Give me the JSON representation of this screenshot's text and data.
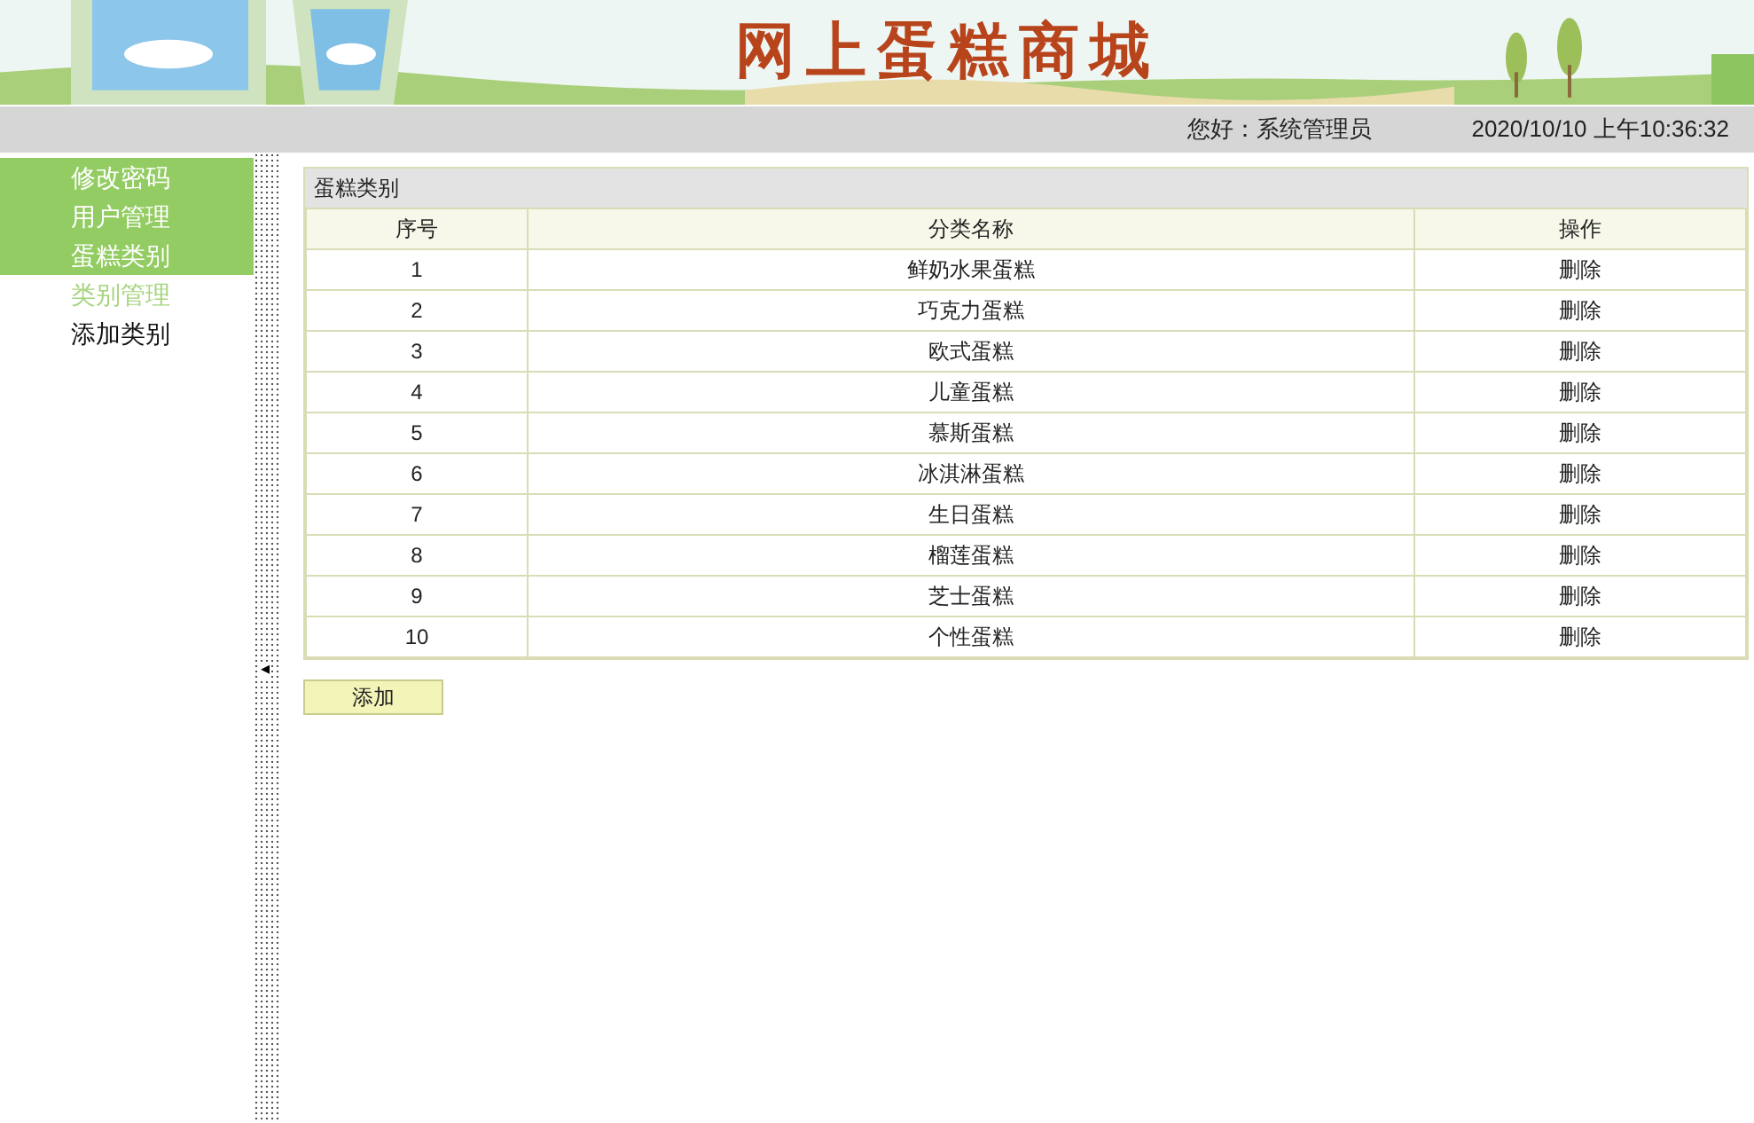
{
  "header": {
    "title": "网上蛋糕商城",
    "greeting": "您好：系统管理员",
    "datetime": "2020/10/10 上午10:36:32"
  },
  "sidebar": {
    "items": [
      {
        "kind": "group",
        "label": "修改密码",
        "selected": false
      },
      {
        "kind": "group",
        "label": "用户管理",
        "selected": false
      },
      {
        "kind": "group",
        "label": "蛋糕类别",
        "selected": false
      },
      {
        "kind": "item",
        "label": "类别管理",
        "selected": true
      },
      {
        "kind": "item",
        "label": "添加类别",
        "selected": false
      }
    ]
  },
  "splitter": {
    "arrow": "◂"
  },
  "table": {
    "title": "蛋糕类别",
    "columns": [
      "序号",
      "分类名称",
      "操作"
    ],
    "rows": [
      {
        "no": "1",
        "name": "鲜奶水果蛋糕",
        "action": "删除"
      },
      {
        "no": "2",
        "name": "巧克力蛋糕",
        "action": "删除"
      },
      {
        "no": "3",
        "name": "欧式蛋糕",
        "action": "删除"
      },
      {
        "no": "4",
        "name": "儿童蛋糕",
        "action": "删除"
      },
      {
        "no": "5",
        "name": "慕斯蛋糕",
        "action": "删除"
      },
      {
        "no": "6",
        "name": "冰淇淋蛋糕",
        "action": "删除"
      },
      {
        "no": "7",
        "name": "生日蛋糕",
        "action": "删除"
      },
      {
        "no": "8",
        "name": "榴莲蛋糕",
        "action": "删除"
      },
      {
        "no": "9",
        "name": "芝士蛋糕",
        "action": "删除"
      },
      {
        "no": "10",
        "name": "个性蛋糕",
        "action": "删除"
      }
    ]
  },
  "add_button": "添加"
}
